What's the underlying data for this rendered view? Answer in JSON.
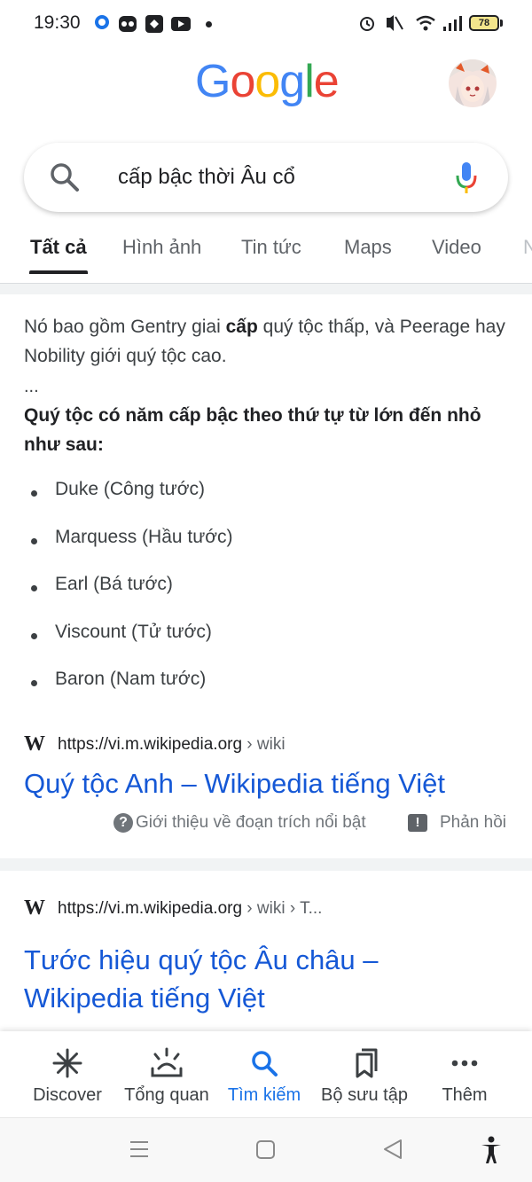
{
  "status_bar": {
    "time": "19:30",
    "battery": "78",
    "icons": [
      "app-notification-icon",
      "owl-app-icon",
      "puzzle-app-icon",
      "youtube-icon",
      "alarm-icon",
      "mute-icon",
      "wifi-icon",
      "signal-icon",
      "battery-icon"
    ]
  },
  "header": {
    "logo_letters": [
      "G",
      "o",
      "o",
      "g",
      "l",
      "e"
    ],
    "logo_colors": [
      "#4285F4",
      "#EA4335",
      "#FBBC05",
      "#4285F4",
      "#34A853",
      "#EA4335"
    ]
  },
  "search": {
    "query": "cấp bậc thời Âu cổ"
  },
  "tabs": [
    {
      "label": "Tất cả",
      "active": true
    },
    {
      "label": "Hình ảnh",
      "active": false
    },
    {
      "label": "Tin tức",
      "active": false
    },
    {
      "label": "Maps",
      "active": false
    },
    {
      "label": "Video",
      "active": false
    },
    {
      "label": "N",
      "active": false
    }
  ],
  "snippet": {
    "text_before": "Nó bao gồm Gentry giai ",
    "text_bold": "cấp",
    "text_after": " quý tộc thấp, và Peerage hay Nobility giới quý tộc cao.",
    "ellipsis": "...",
    "heading": "Quý tộc có năm cấp bậc theo thứ tự từ lớn đến nhỏ như sau:",
    "bullets": [
      "Duke (Công tước)",
      "Marquess (Hầu tước)",
      "Earl (Bá tước)",
      "Viscount (Tử tước)",
      "Baron (Nam tước)"
    ]
  },
  "result1": {
    "favicon": "W",
    "url": "https://vi.m.wikipedia.org",
    "crumb": " › wiki",
    "title": "Quý tộc Anh – Wikipedia tiếng Việt",
    "about_label": "Giới thiệu về đoạn trích nổi bật",
    "feedback_label": "Phản hồi"
  },
  "result2": {
    "favicon": "W",
    "url": "https://vi.m.wikipedia.org",
    "crumb": " › wiki › T...",
    "title": "Tước hiệu quý tộc Âu châu – Wikipedia tiếng Việt"
  },
  "bottom_nav": [
    {
      "label": "Discover",
      "icon": "asterisk-icon",
      "active": false
    },
    {
      "label": "Tổng quan",
      "icon": "overview-icon",
      "active": false
    },
    {
      "label": "Tìm kiếm",
      "icon": "search-icon",
      "active": true
    },
    {
      "label": "Bộ sưu tập",
      "icon": "collections-icon",
      "active": false
    },
    {
      "label": "Thêm",
      "icon": "more-icon",
      "active": false
    }
  ],
  "system_nav": [
    "menu-icon",
    "home-icon",
    "back-icon",
    "accessibility-icon"
  ],
  "colors": {
    "link": "#1558d6",
    "active_nav": "#1a73e8"
  }
}
